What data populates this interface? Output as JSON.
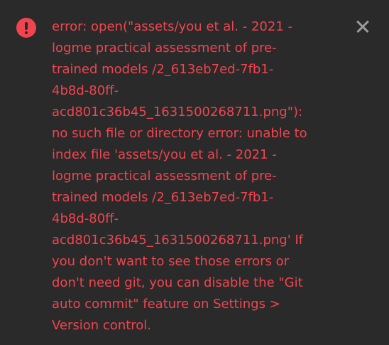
{
  "notification": {
    "type": "error",
    "icon": "exclamation-circle-icon",
    "close_icon": "close-icon",
    "message": "error: open(\"assets/you et al. - 2021 -\nlogme practical assessment of pre-\ntrained models /2_613eb7ed-7fb1-\n4b8d-80ff-\nacd801c36b45_1631500268711.png\"):\nno such file or directory error: unable to\nindex file 'assets/you et al. - 2021 -\nlogme practical assessment of pre-\ntrained models /2_613eb7ed-7fb1-\n4b8d-80ff-\nacd801c36b45_1631500268711.png' If\nyou don't want to see those errors or\ndon't need git, you can disable the \"Git\nauto commit\" feature on Settings >\nVersion control."
  },
  "colors": {
    "background": "#2a2a2a",
    "error_text": "#f0454f",
    "close_icon": "#9a9a9a"
  }
}
